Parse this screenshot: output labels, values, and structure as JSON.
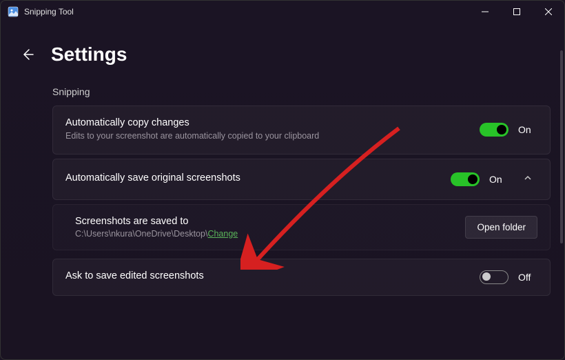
{
  "window": {
    "title": "Snipping Tool"
  },
  "page": {
    "title": "Settings"
  },
  "section": {
    "label": "Snipping"
  },
  "settings": {
    "auto_copy": {
      "title": "Automatically copy changes",
      "desc": "Edits to your screenshot are automatically copied to your clipboard",
      "state_label": "On"
    },
    "auto_save": {
      "title": "Automatically save original screenshots",
      "state_label": "On"
    },
    "save_location": {
      "title": "Screenshots are saved to",
      "path": "C:\\Users\\nkura\\OneDrive\\Desktop\\",
      "change_label": "Change",
      "open_folder_label": "Open folder"
    },
    "ask_save": {
      "title": "Ask to save edited screenshots",
      "state_label": "Off"
    }
  }
}
